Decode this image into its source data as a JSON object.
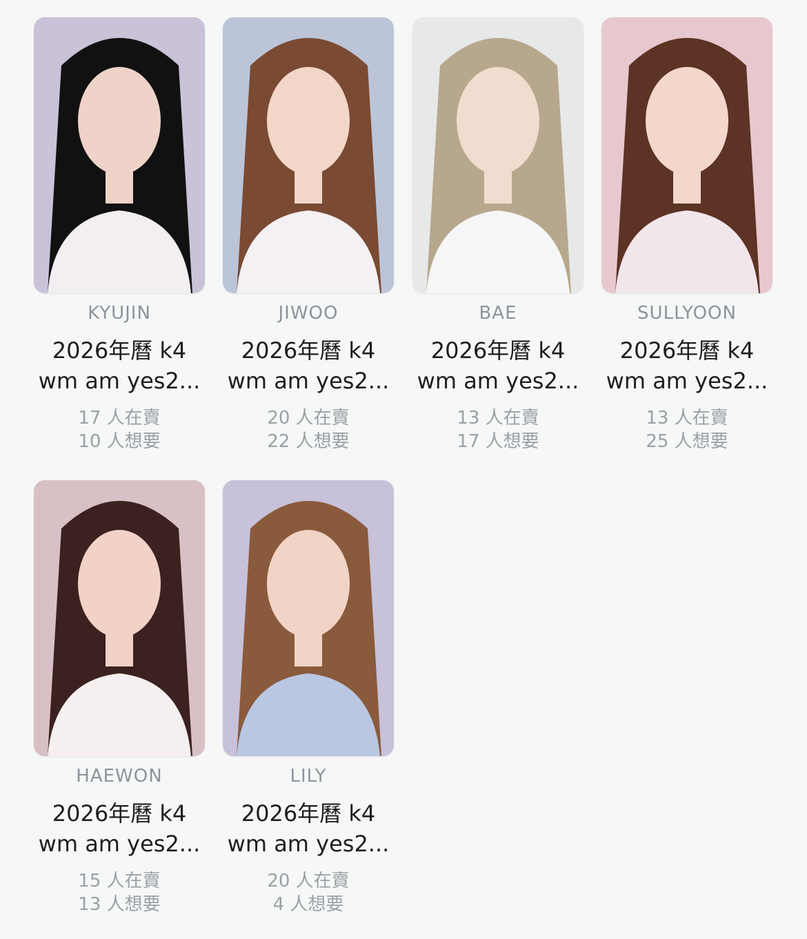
{
  "items": [
    {
      "member": "KYUJIN",
      "title_line1": "2026年曆 k4",
      "title_line2": "wm am yes2...",
      "selling": "17 人在賣",
      "wanting": "10 人想要",
      "bg": "#c9c2d8",
      "hair": "#111111",
      "skin": "#efd3c8",
      "top": "#f2eef2"
    },
    {
      "member": "JIWOO",
      "title_line1": "2026年曆 k4",
      "title_line2": "wm am yes2...",
      "selling": "20 人在賣",
      "wanting": "22 人想要",
      "bg": "#bcc4d8",
      "hair": "#7a4a33",
      "skin": "#f2d6c8",
      "top": "#f4f0f4"
    },
    {
      "member": "BAE",
      "title_line1": "2026年曆 k4",
      "title_line2": "wm am yes2...",
      "selling": "13 人在賣",
      "wanting": "17 人想要",
      "bg": "#e7e8e8",
      "hair": "#b7a88d",
      "skin": "#f1dccf",
      "top": "#f6f6f6"
    },
    {
      "member": "SULLYOON",
      "title_line1": "2026年曆 k4",
      "title_line2": "wm am yes2...",
      "selling": "13 人在賣",
      "wanting": "25 人想要",
      "bg": "#e8c8cf",
      "hair": "#5c3324",
      "skin": "#f3d7cb",
      "top": "#f1e6ea"
    },
    {
      "member": "HAEWON",
      "title_line1": "2026年曆 k4",
      "title_line2": "wm am yes2...",
      "selling": "15 人在賣",
      "wanting": "13 人想要",
      "bg": "#d8c0c4",
      "hair": "#3b2220",
      "skin": "#f2d2c6",
      "top": "#f5f0ef"
    },
    {
      "member": "LILY",
      "title_line1": "2026年曆 k4",
      "title_line2": "wm am yes2...",
      "selling": "20 人在賣",
      "wanting": "4 人想要",
      "bg": "#c7c1d9",
      "hair": "#8a5a3c",
      "skin": "#f1d4c6",
      "top": "#b9c7e3"
    }
  ]
}
